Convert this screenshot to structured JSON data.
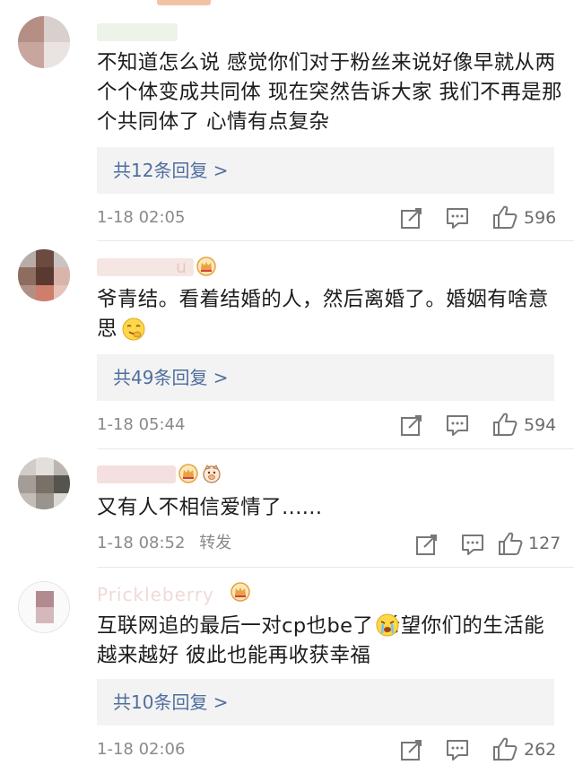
{
  "comments": [
    {
      "username": "",
      "text": "不知道怎么说 感觉你们对于粉丝来说好像早就从两个个体变成共同体 现在突然告诉大家 我们不再是那个共同体了 心情有点复杂",
      "reply_label": "共12条回复 >",
      "time": "1-18 02:05",
      "likes": "596"
    },
    {
      "username": "u",
      "text": "爷青结。看着结婚的人，然后离婚了。婚姻有啥意思",
      "reply_label": "共49条回复 >",
      "time": "1-18 05:44",
      "likes": "594"
    },
    {
      "username": "",
      "text": "又有人不相信爱情了......",
      "reply_label": "",
      "time": "1-18 08:52",
      "forward_label": "转发",
      "likes": "127"
    },
    {
      "username": "Prickleberry",
      "text": "互联网追的最后一对cp也be了 希望你们的生活能越来越好 彼此也能再收获幸福",
      "reply_label": "共10条回复 >",
      "time": "1-18 02:06",
      "likes": "262"
    }
  ],
  "colors": {
    "reply_link": "#4f6e9e",
    "meta_text": "#8a8a8a",
    "crown_badge": "#e9a23b"
  },
  "icons": [
    "edit-icon",
    "comment-icon",
    "like-icon",
    "crown-badge-icon",
    "pig-badge-icon",
    "sneaky-smile-emoji",
    "crying-emoji"
  ]
}
